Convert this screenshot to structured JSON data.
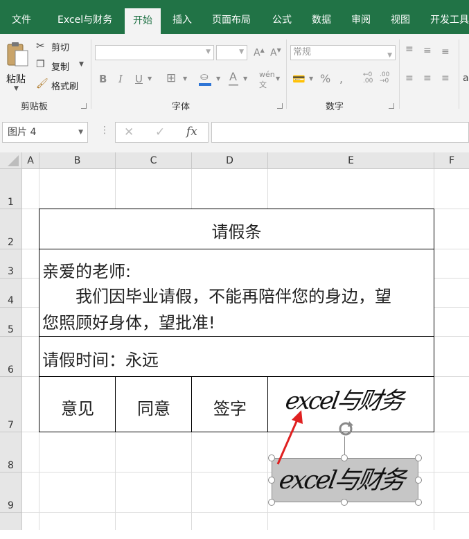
{
  "ribbon_tabs": [
    "文件",
    "Excel与财务",
    "开始",
    "插入",
    "页面布局",
    "公式",
    "数据",
    "审阅",
    "视图",
    "开发工具"
  ],
  "active_tab": "开始",
  "clipboard": {
    "paste": "粘贴",
    "cut": "剪切",
    "copy": "复制",
    "format_painter": "格式刷",
    "group_label": "剪贴板"
  },
  "font_group": {
    "group_label": "字体",
    "bold": "B",
    "italic": "I",
    "underline": "U"
  },
  "number_group": {
    "format_value": "常规",
    "group_label": "数字",
    "percent": "%"
  },
  "formula_bar": {
    "name_box": "图片 4",
    "fx": "fx"
  },
  "columns": [
    "A",
    "B",
    "C",
    "D",
    "E",
    "F"
  ],
  "rows": [
    "1",
    "2",
    "3",
    "4",
    "5",
    "6",
    "7",
    "8",
    "9"
  ],
  "form": {
    "title": "请假条",
    "greeting": "亲爱的老师:",
    "body_line1": "我们因毕业请假，不能再陪伴您的身边，望",
    "body_line2": "您照顾好身体，望批准!",
    "leave_time": "请假时间：永远",
    "opinion_label": "意见",
    "opinion_value": "同意",
    "sign_label": "签字"
  },
  "signature_text": "excel与财务",
  "colors": {
    "ribbon_green": "#217346",
    "arrow_red": "#e02020",
    "picture_fill": "#c6c6c6"
  }
}
